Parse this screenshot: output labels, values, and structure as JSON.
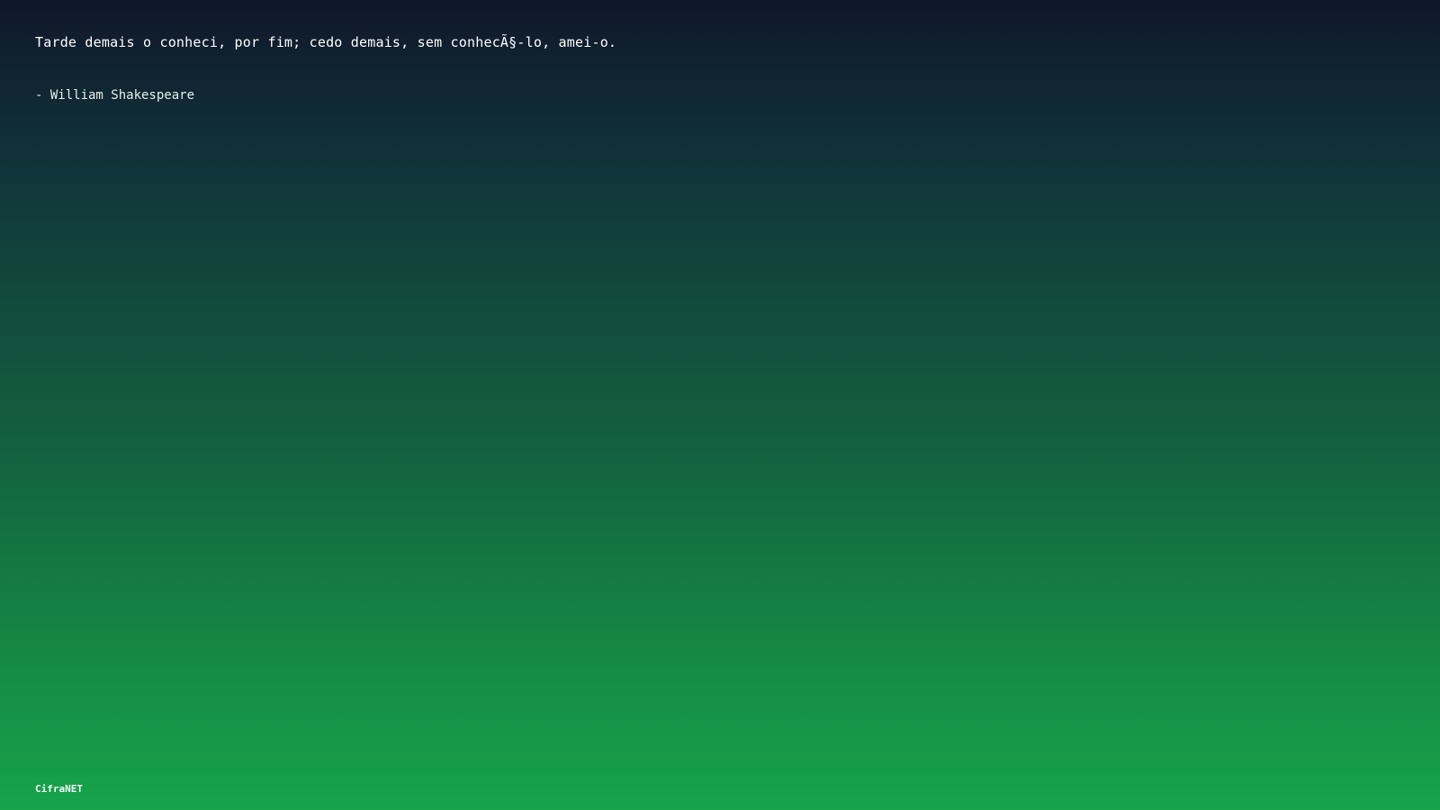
{
  "quote": {
    "text": "Tarde demais o conheci, por fim; cedo demais, sem conhecÃ§-lo, amei-o.",
    "author": "- William Shakespeare"
  },
  "footer": {
    "brand": "CifraNET"
  },
  "colors": {
    "gradient_top": "#0f172a",
    "gradient_bottom": "#16a34a",
    "text": "#ffffff"
  }
}
